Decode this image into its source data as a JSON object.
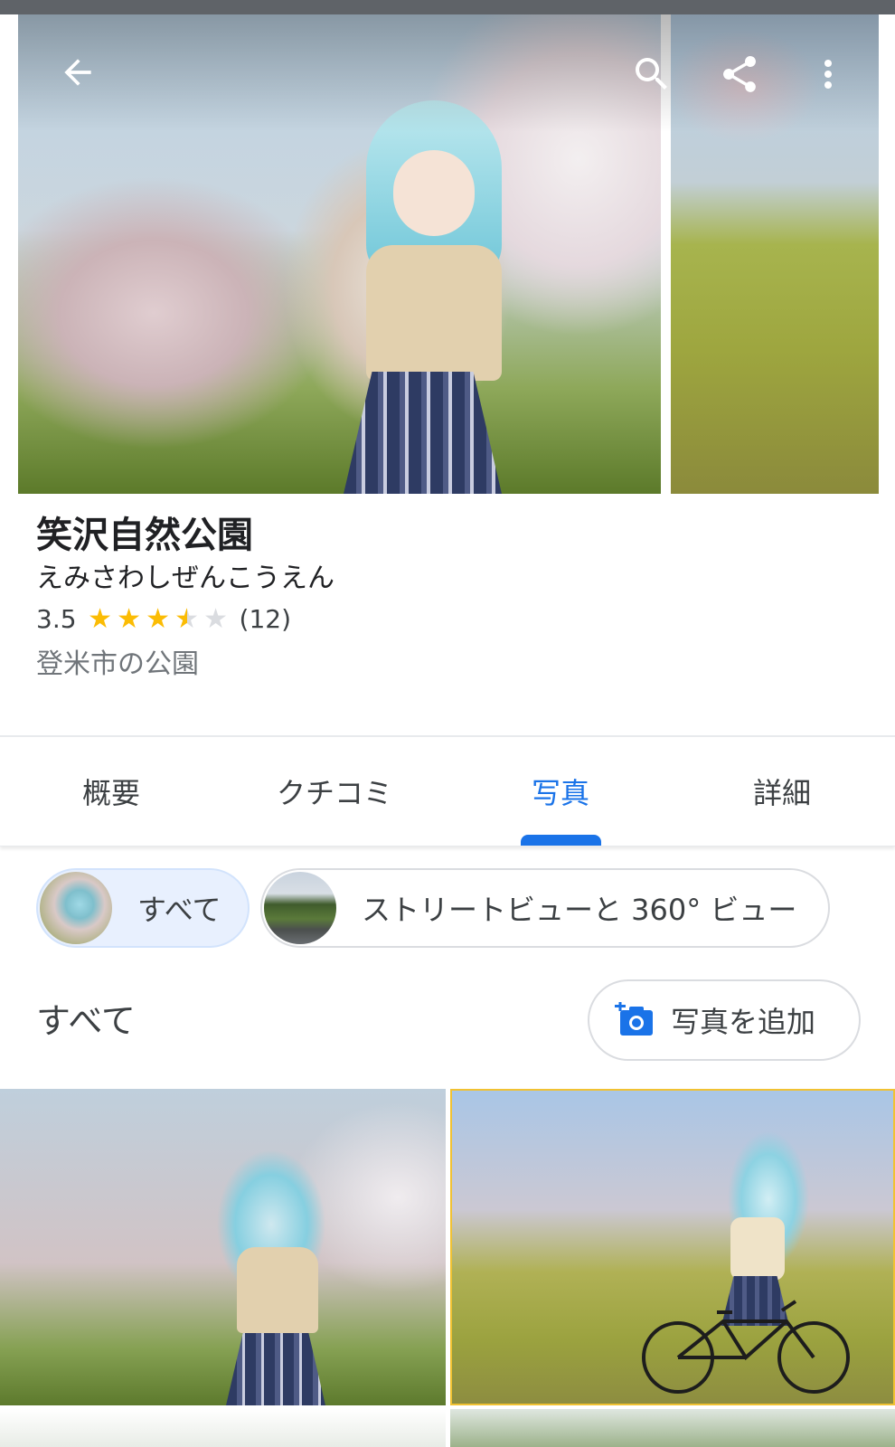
{
  "place": {
    "name": "笑沢自然公園",
    "reading": "えみさわしぜんこうえん",
    "rating": "3.5",
    "rating_value": 3.5,
    "review_count": "(12)",
    "category": "登米市の公園"
  },
  "tabs": [
    {
      "label": "概要",
      "active": false
    },
    {
      "label": "クチコミ",
      "active": false
    },
    {
      "label": "写真",
      "active": true
    },
    {
      "label": "詳細",
      "active": false
    }
  ],
  "filters": [
    {
      "label": "すべて",
      "selected": true
    },
    {
      "label": "ストリートビューと 360° ビュー",
      "selected": false
    }
  ],
  "photos_section": {
    "title": "すべて",
    "add_photo_label": "写真を追加"
  },
  "icons": {
    "back": "back-arrow-icon",
    "search": "search-icon",
    "share": "share-icon",
    "more": "more-vert-icon",
    "add_photo": "add-photo-camera-icon",
    "star": "star-icon"
  },
  "colors": {
    "accent": "#1a73e8",
    "star": "#fbbc04",
    "chip_selected_bg": "#e8f0fe"
  }
}
